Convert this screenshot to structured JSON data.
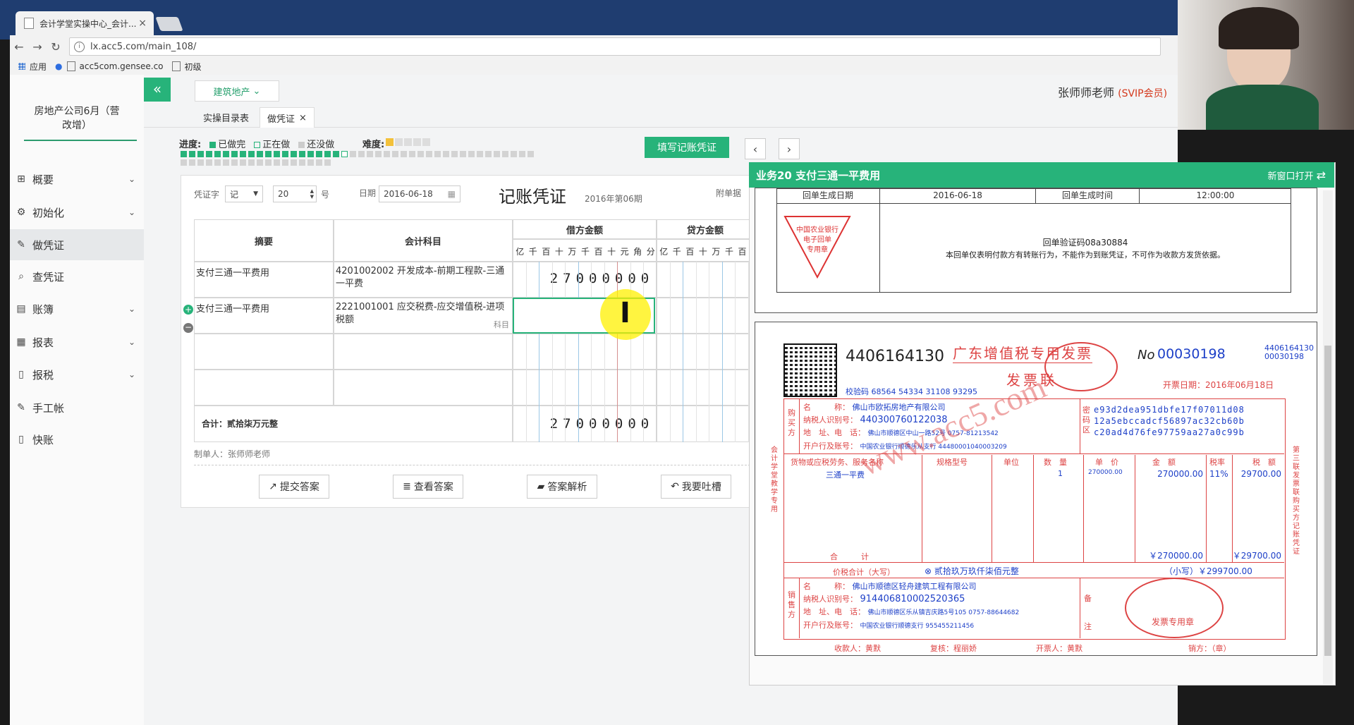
{
  "browser": {
    "tab_title": "会计学堂实操中心_会计...",
    "url": "lx.acc5.com/main_108/",
    "bookmarks": [
      "应用",
      "acc5com.gensee.co",
      "初级"
    ]
  },
  "sidebar": {
    "company": "房地产公司6月（营改增）",
    "items": [
      {
        "label": "概要",
        "icon": "dashboard-icon",
        "has_children": true
      },
      {
        "label": "初始化",
        "icon": "gear-icon",
        "has_children": true
      },
      {
        "label": "做凭证",
        "icon": "pen-icon",
        "has_children": false,
        "active": true
      },
      {
        "label": "查凭证",
        "icon": "search-icon",
        "has_children": false
      },
      {
        "label": "账簿",
        "icon": "book-icon",
        "has_children": true
      },
      {
        "label": "报表",
        "icon": "report-icon",
        "has_children": true
      },
      {
        "label": "报税",
        "icon": "file-icon",
        "has_children": true
      },
      {
        "label": "手工帐",
        "icon": "pen-icon",
        "has_children": false
      },
      {
        "label": "快账",
        "icon": "file-icon",
        "has_children": false
      }
    ]
  },
  "header": {
    "industry": "建筑地产",
    "user": "张师师老师",
    "vip": "(SVIP会员)"
  },
  "page_tabs": [
    {
      "label": "实操目录表"
    },
    {
      "label": "做凭证",
      "close": "×"
    }
  ],
  "progress": {
    "label": "进度:",
    "done": "已做完",
    "doing": "正在做",
    "todo": "还没做",
    "difficulty_label": "难度:",
    "difficulty_stars": 1,
    "difficulty_max": 5,
    "done_count": 19,
    "current_index": 20,
    "total": 60
  },
  "fill_button": "填写记账凭证",
  "nav": {
    "prev": "‹",
    "next": "›"
  },
  "voucher": {
    "word_label": "凭证字",
    "word_value": "记",
    "number": "20",
    "number_suffix": "号",
    "date_label": "日期",
    "date_value": "2016-06-18",
    "title": "记账凭证",
    "period": "2016年第06期",
    "attach_label": "附单据",
    "headers": {
      "summary": "摘要",
      "account": "会计科目",
      "debit": "借方金额",
      "credit": "贷方金额",
      "digits": [
        "亿",
        "千",
        "百",
        "十",
        "万",
        "千",
        "百",
        "十",
        "元",
        "角",
        "分"
      ]
    },
    "rows": [
      {
        "summary": "支付三通一平费用",
        "account": "4201002002 开发成本-前期工程款-三通一平费",
        "debit": "27000000",
        "credit": ""
      },
      {
        "summary": "支付三通一平费用",
        "account": "2221001001 应交税费-应交增值税-进项税额",
        "account_hint": "科目",
        "debit": "",
        "credit": ""
      },
      {
        "summary": "",
        "account": "",
        "debit": "",
        "credit": ""
      },
      {
        "summary": "",
        "account": "",
        "debit": "",
        "credit": ""
      }
    ],
    "total_label": "合计：贰拾柒万元整",
    "total_debit": "27000000",
    "maker": "制单人：张师师老师",
    "buttons": [
      "提交答案",
      "查看答案",
      "答案解析",
      "我要吐槽"
    ]
  },
  "document": {
    "title": "业务20 支付三通一平费用",
    "open_new": "新窗口打开",
    "receipt": {
      "gen_date_label": "回单生成日期",
      "gen_date": "2016-06-18",
      "gen_time_label": "回单生成时间",
      "gen_time": "12:00:00",
      "stamp_lines": [
        "中国农业银行",
        "电子回单",
        "专用章"
      ],
      "verify": "回单验证码08a30884",
      "note": "本回单仅表明付款方有转账行为，不能作为到账凭证，不可作为收款方发货依据。"
    },
    "invoice": {
      "code": "4406164130",
      "title": "广东增值税专用发票",
      "subtitle": "发票联",
      "no_label": "No",
      "no": "00030198",
      "side_code": "4406164130",
      "side_no": "00030198",
      "check_code": "校验码 68564 54334 31108 93295",
      "issue_date": "开票日期：2016年06月18日",
      "buyer": {
        "name_label": "名　　　称：",
        "name": "佛山市欧拓房地产有限公司",
        "tax_label": "纳税人识别号：",
        "tax": "440300760122038",
        "addr_label": "地　址、电　话：",
        "addr": "佛山市顺德区中山一路52号 0757-81213542",
        "bank_label": "开户行及账号：",
        "bank": "中国农业银行顺德乐从支行 44480001040003209"
      },
      "cipher": [
        "e93d2dea951dbfe17f07011d08",
        "12a5ebccadcf56897ac32cb60b",
        "c20ad4d76fe97759aa27a0c99b"
      ],
      "cols": [
        "货物或应税劳务、服务名称",
        "规格型号",
        "单位",
        "数　量",
        "单　价",
        "金　额",
        "税率",
        "税　额"
      ],
      "item": {
        "name": "三通一平费",
        "qty": "1",
        "price": "270000.00",
        "amount": "270000.00",
        "rate": "11%",
        "tax": "29700.00"
      },
      "sum_label": "合　　　计",
      "sum_amount": "￥270000.00",
      "sum_tax": "￥29700.00",
      "total_label": "价税合计（大写）",
      "total_words": "⊗ 贰拾玖万玖仟柒佰元整",
      "total_small": "（小写）￥299700.00",
      "seller": {
        "name": "佛山市顺德区轻舟建筑工程有限公司",
        "tax": "914406810002520365",
        "addr": "佛山市顺德区乐从镇吉庆路5号105 0757-88644682",
        "bank": "中国农业银行顺德支行 955455211456"
      },
      "payee": "收款人：黄默",
      "reviewer": "复核：程丽娇",
      "drawer": "开票人：黄默",
      "seller_side": "销方：（章）",
      "left_side": "会计学堂教学专用",
      "right_side": [
        "第三联",
        "发票联",
        "购买方记账凭证"
      ],
      "stamp_text": "发票专用章",
      "watermark": "www.acc5.com"
    }
  },
  "colors": {
    "accent": "#27b37a",
    "invoice_red": "#d44444",
    "vip": "#d4381c"
  }
}
